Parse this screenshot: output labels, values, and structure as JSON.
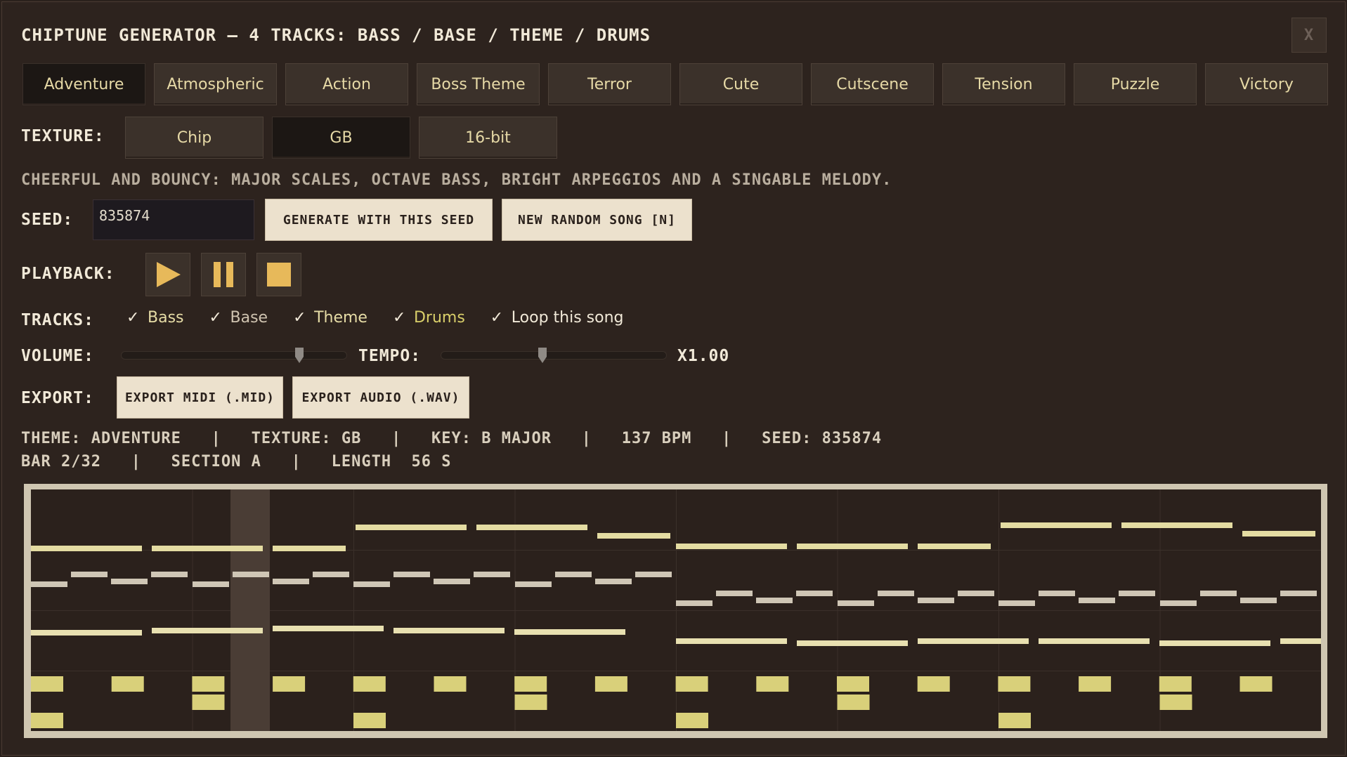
{
  "header": {
    "title": "CHIPTUNE GENERATOR  —  4 TRACKS: BASS / BASE / THEME / DRUMS",
    "close_label": "X"
  },
  "themes": [
    {
      "label": "Adventure",
      "selected": true
    },
    {
      "label": "Atmospheric",
      "selected": false
    },
    {
      "label": "Action",
      "selected": false
    },
    {
      "label": "Boss Theme",
      "selected": false
    },
    {
      "label": "Terror",
      "selected": false
    },
    {
      "label": "Cute",
      "selected": false
    },
    {
      "label": "Cutscene",
      "selected": false
    },
    {
      "label": "Tension",
      "selected": false
    },
    {
      "label": "Puzzle",
      "selected": false
    },
    {
      "label": "Victory",
      "selected": false
    }
  ],
  "texture": {
    "label": "TEXTURE:",
    "options": [
      {
        "label": "Chip",
        "selected": false
      },
      {
        "label": "GB",
        "selected": true
      },
      {
        "label": "16-bit",
        "selected": false
      }
    ]
  },
  "description": "CHEERFUL AND BOUNCY: MAJOR SCALES, OCTAVE BASS, BRIGHT ARPEGGIOS AND A SINGABLE MELODY.",
  "seed": {
    "label": "SEED:",
    "value": "835874",
    "generate_label": "GENERATE WITH THIS SEED",
    "random_label": "NEW RANDOM SONG  [N]"
  },
  "playback": {
    "label": "PLAYBACK:",
    "play_icon": "play-icon",
    "pause_icon": "pause-icon",
    "stop_icon": "stop-icon"
  },
  "tracks": {
    "label": "TRACKS:",
    "items": [
      {
        "label": "Bass",
        "checked": true,
        "color": "#e6dca6"
      },
      {
        "label": "Base",
        "checked": true,
        "color": "#cfc3b0"
      },
      {
        "label": "Theme",
        "checked": true,
        "color": "#e6dca6"
      },
      {
        "label": "Drums",
        "checked": true,
        "color": "#d9cf6a"
      },
      {
        "label": "Loop this song",
        "checked": true,
        "color": "#f1e9d8"
      }
    ]
  },
  "volume": {
    "label": "VOLUME:",
    "level": 0.79
  },
  "tempo": {
    "label": "TEMPO:",
    "level": 0.45,
    "value": "X1.00"
  },
  "export": {
    "label": "EXPORT:",
    "midi_label": "EXPORT MIDI (.MID)",
    "wav_label": "EXPORT AUDIO (.WAV)"
  },
  "status": {
    "line1": "THEME: ADVENTURE   |   TEXTURE: GB   |   KEY: B MAJOR   |   137 BPM   |   SEED: 835874",
    "line2": "BAR 2/32   |   SECTION A   |   LENGTH  56 S"
  },
  "colors": {
    "accent": "#e7b95a",
    "note_bass": "#e4dca2",
    "note_base": "#cfc6b5",
    "note_theme": "#e8e0b0",
    "note_drum": "#d9d07a",
    "playhead": "#4a3d35"
  }
}
